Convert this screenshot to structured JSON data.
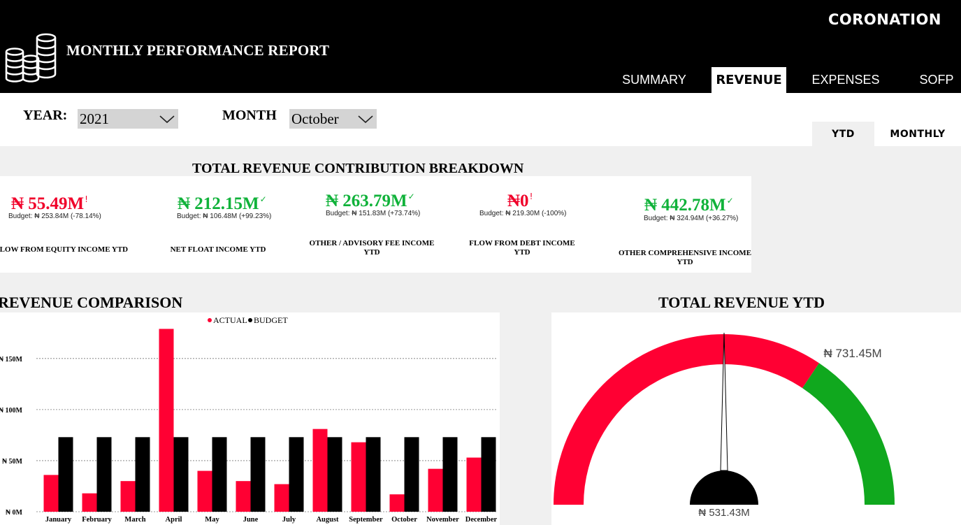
{
  "header": {
    "title": "MONTHLY PERFORMANCE REPORT",
    "brand": "CORONATION",
    "icon": "coins-stack-icon",
    "tabs": [
      {
        "label": "SUMMARY",
        "active": false
      },
      {
        "label": "REVENUE",
        "active": true
      },
      {
        "label": "EXPENSES",
        "active": false
      },
      {
        "label": "SOFP",
        "active": false
      }
    ]
  },
  "filters": {
    "year_label": "YEAR:",
    "year_value": "2021",
    "month_label": "MONTH",
    "month_value": "October",
    "toggle": [
      {
        "label": "YTD",
        "active": false
      },
      {
        "label": "MONTHLY",
        "active": true
      }
    ]
  },
  "breakdown": {
    "title": "TOTAL REVENUE CONTRIBUTION BREAKDOWN",
    "cards": [
      {
        "value": "₦ 55.49M",
        "mark": "!",
        "status": "below",
        "budget": "Budget: ₦ 253.84M (-78.14%)",
        "label": "FLOW FROM EQUITY INCOME YTD"
      },
      {
        "value": "₦ 212.15M",
        "mark": "✓",
        "status": "above",
        "budget": "Budget: ₦ 106.48M (+99.23%)",
        "label": "NET FLOAT INCOME YTD"
      },
      {
        "value": "₦ 263.79M",
        "mark": "✓",
        "status": "above",
        "budget": "Budget: ₦ 151.83M (+73.74%)",
        "label": "OTHER / ADVISORY FEE INCOME YTD"
      },
      {
        "value": "₦0",
        "mark": "!",
        "status": "below",
        "budget": "Budget: ₦ 219.30M (-100%)",
        "label": "FLOW FROM DEBT INCOME YTD"
      },
      {
        "value": "₦ 442.78M",
        "mark": "✓",
        "status": "above",
        "budget": "Budget: ₦ 324.94M (+36.27%)",
        "label": "OTHER COMPREHENSIVE INCOME YTD"
      }
    ]
  },
  "colors": {
    "actual": "#ff0033",
    "budget": "#000000",
    "gauge_red": "#ff0033",
    "gauge_green": "#10a81e",
    "above": "#10b23a",
    "below": "#f0002a"
  },
  "chart_data": [
    {
      "type": "bar",
      "title": "REVENUE COMPARISON",
      "categories": [
        "January",
        "February",
        "March",
        "April",
        "May",
        "June",
        "July",
        "August",
        "September",
        "October",
        "November",
        "December"
      ],
      "series": [
        {
          "name": "ACTUAL",
          "values": [
            36,
            18,
            30,
            179,
            40,
            30,
            27,
            81,
            68,
            17,
            42,
            53
          ]
        },
        {
          "name": "BUDGET",
          "values": [
            73,
            73,
            73,
            73,
            73,
            73,
            73,
            73,
            73,
            73,
            73,
            73
          ]
        }
      ],
      "yticks": [
        0,
        50,
        100,
        150
      ],
      "ytick_labels": [
        "₦ 0M",
        "₦ 50M",
        "₦ 100M",
        "₦ 150M"
      ],
      "ylim": [
        0,
        180
      ],
      "grid": true,
      "legend": "top-center"
    },
    {
      "type": "gauge",
      "title": "TOTAL REVENUE YTD",
      "value": 531.43,
      "value_label": "₦ 531.43M",
      "target": 731.45,
      "target_label": "₦ 731.45M",
      "min": 0,
      "max": 1062.86
    }
  ]
}
